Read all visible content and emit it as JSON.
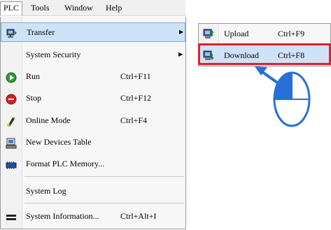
{
  "menubar": {
    "items": [
      {
        "label": "PLC"
      },
      {
        "label": "Tools"
      },
      {
        "label": "Window"
      },
      {
        "label": "Help"
      }
    ]
  },
  "menu": {
    "transfer": {
      "label": "Transfer"
    },
    "system_security": {
      "label": "System Security"
    },
    "run": {
      "label": "Run",
      "shortcut": "Ctrl+F11"
    },
    "stop": {
      "label": "Stop",
      "shortcut": "Ctrl+F12"
    },
    "online_mode": {
      "label": "Online Mode",
      "shortcut": "Ctrl+F4"
    },
    "new_devices_table": {
      "label": "New Devices Table"
    },
    "format_plc_memory": {
      "label": "Format PLC Memory..."
    },
    "system_log": {
      "label": "System Log"
    },
    "system_information": {
      "label": "System Information...",
      "shortcut": "Ctrl+Alt+I"
    }
  },
  "submenu": {
    "upload": {
      "label": "Upload",
      "shortcut": "Ctrl+F9"
    },
    "download": {
      "label": "Download",
      "shortcut": "Ctrl+F8"
    }
  },
  "colors": {
    "highlight": "#cfe3f8",
    "callout_red": "#e0202a",
    "pointer_blue": "#2a6fd6"
  }
}
